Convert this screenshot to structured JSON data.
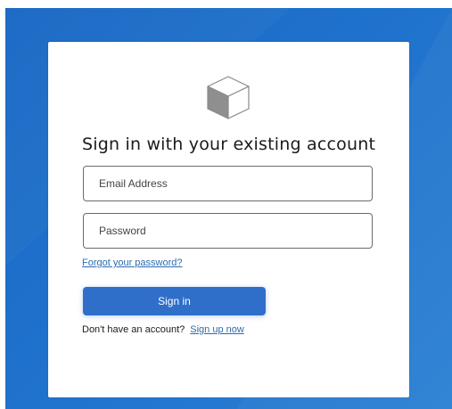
{
  "colors": {
    "background_blue": "#1f72cc",
    "button_blue": "#2f6fca",
    "link_blue": "#2b6cb0"
  },
  "logo": {
    "icon": "cube-icon"
  },
  "form": {
    "title": "Sign in with your existing account",
    "email_placeholder": "Email Address",
    "password_placeholder": "Password",
    "forgot_password_link": "Forgot your password?",
    "signin_button": "Sign in",
    "no_account_text": "Don't have an account?",
    "signup_link": "Sign up now"
  }
}
